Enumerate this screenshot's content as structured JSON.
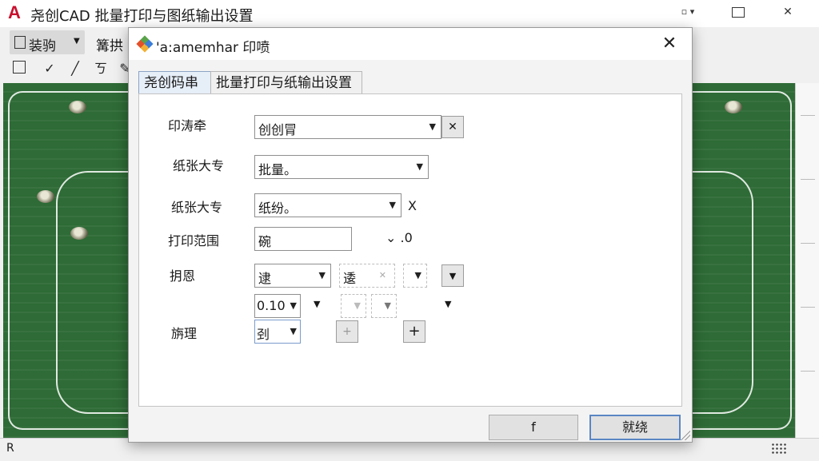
{
  "app": {
    "logo": "A",
    "title": "尧创CAD 批量打印与图纸输出设置",
    "pin_glyph": "▫ ▾",
    "close_glyph": "✕"
  },
  "toolbar": {
    "ribbon_label": "装驹",
    "ribbon_next": "篝拱"
  },
  "statusbar": {
    "text": "R"
  },
  "dialog": {
    "title": "'a:amemhar 印喷",
    "close_glyph": "✕",
    "tabs": [
      {
        "label": "尧创码串",
        "active": true
      },
      {
        "label": "批量打印与纸输出设置",
        "active": false
      }
    ],
    "fields": {
      "printer": {
        "label": "印涛牵",
        "value": "创创冐",
        "clear": "✕"
      },
      "paper_size1": {
        "label": "纸张大专",
        "value": "批量。"
      },
      "paper_size2": {
        "label": "纸张大专",
        "value": "纸纷。",
        "suffix": "X"
      },
      "print_range": {
        "label": "打印范围",
        "value": "碗",
        "suffix": "⌄ .0"
      },
      "settings": {
        "label": "抈恩",
        "value1": "逮",
        "value2": "逶"
      },
      "scale": {
        "value": "0.10"
      },
      "process": {
        "label": "旃理",
        "value": "刭",
        "plus": "+"
      }
    },
    "buttons": {
      "left": "f",
      "right": "就绕"
    }
  },
  "colors": {
    "canvas_green": "#2e6b36",
    "accent_red": "#c8102e",
    "primary_border": "#5a86c4"
  }
}
